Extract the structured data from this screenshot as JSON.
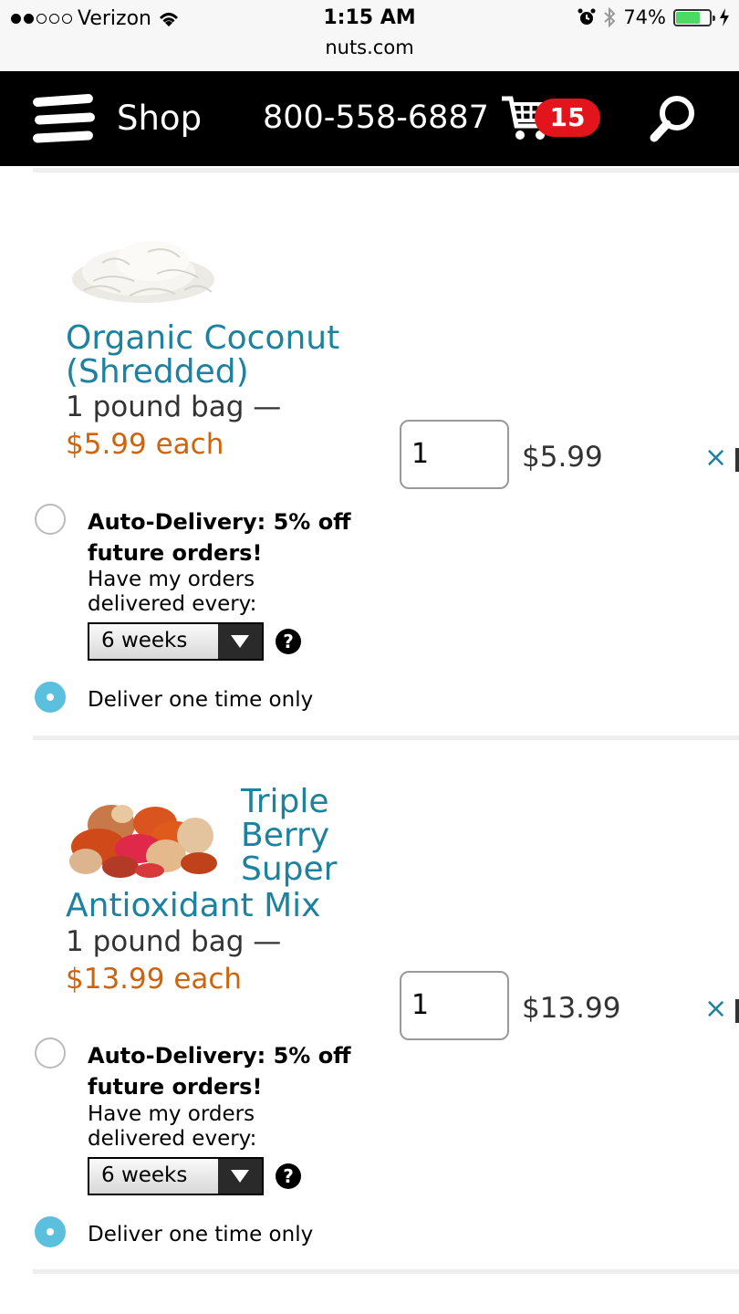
{
  "status_bar": {
    "carrier": "Verizon",
    "time": "1:15 AM",
    "url": "nuts.com",
    "battery": "74%",
    "battery_level": 0.74
  },
  "nav": {
    "shop_label": "Shop",
    "phone": "800-558-6887",
    "cart_count": "15",
    "icons": [
      "menu-icon",
      "cart-icon",
      "search-icon"
    ]
  },
  "items": [
    {
      "title_line1": "Organic Coconut",
      "title_line2": "(Shredded)",
      "size": "1 pound bag —",
      "price_each": "$5.99 each",
      "quantity": "1",
      "line_total": "$5.99",
      "remove": "×",
      "auto_delivery_title": "Auto-Delivery: 5% off future orders!",
      "auto_delivery_desc": "Have my orders delivered every:",
      "frequency": "6 weeks",
      "help": "?",
      "one_time_label": "Deliver one time only"
    },
    {
      "title_line1": "Triple",
      "title_line2": "Berry",
      "title_line3": "Super",
      "title_line4": "Antioxidant Mix",
      "size": "1 pound bag —",
      "price_each": "$13.99 each",
      "quantity": "1",
      "line_total": "$13.99",
      "remove": "×",
      "auto_delivery_title": "Auto-Delivery: 5% off future orders!",
      "auto_delivery_desc": "Have my orders delivered every:",
      "frequency": "6 weeks",
      "help": "?",
      "one_time_label": "Deliver one time only"
    }
  ],
  "colors": {
    "link": "#1d82a0",
    "price": "#d0640c",
    "badge": "#e3141b",
    "radio_selected": "#5bc0de"
  }
}
